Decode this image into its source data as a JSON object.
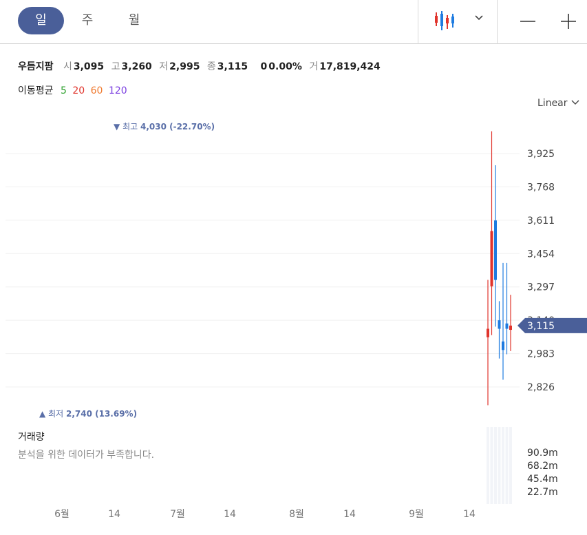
{
  "tabs": [
    "일",
    "주",
    "월"
  ],
  "active_tab": 0,
  "zoom": {
    "out_icon": "minus-icon",
    "in_icon": "plus-icon"
  },
  "chart_type_icon": "candlestick-icon",
  "stock": {
    "name": "우듬지팜",
    "open_label": "시",
    "open": "3,095",
    "high_label": "고",
    "high": "3,260",
    "low_label": "저",
    "low": "2,995",
    "close_label": "종",
    "close": "3,115",
    "change": "0",
    "change_pct": "0.00%",
    "volume_label": "거",
    "volume": "17,819,424"
  },
  "moving_average": {
    "label": "이동평균",
    "periods": [
      {
        "value": "5",
        "color": "#2ca02c"
      },
      {
        "value": "20",
        "color": "#e0342c"
      },
      {
        "value": "60",
        "color": "#f07a30"
      },
      {
        "value": "120",
        "color": "#7b3fe0"
      }
    ]
  },
  "scale_mode": "Linear",
  "volume_section": {
    "title": "거래량",
    "empty_message": "분석을 위한 데이터가 부족합니다.",
    "ticks": [
      "90.9m",
      "68.2m",
      "45.4m",
      "22.7m"
    ]
  },
  "colors": {
    "up": "#e0342c",
    "down": "#1e7be0",
    "accent": "#4a5f99",
    "marker": "#5a6fa8"
  },
  "chart_data": {
    "type": "candlestick",
    "price_ticks": [
      3925,
      3768,
      3611,
      3454,
      3297,
      3140,
      2983,
      2826
    ],
    "price_tick_labels": [
      "3,925",
      "3,768",
      "3,611",
      "3,454",
      "3,297",
      "3,140",
      "2,983",
      "2,826"
    ],
    "current_price": 3115,
    "current_price_label": "3,115",
    "high_marker": {
      "symbol": "▼",
      "label": "최고",
      "value": "4,030 (-22.70%)",
      "price": 4030
    },
    "low_marker": {
      "symbol": "▲",
      "label": "최저",
      "value": "2,740 (13.69%)",
      "price": 2740
    },
    "x_tick_labels": [
      "6월",
      "14",
      "7월",
      "14",
      "8월",
      "14",
      "9월",
      "14"
    ],
    "candles": [
      {
        "open": 3060,
        "high": 3330,
        "low": 2740,
        "close": 3100
      },
      {
        "open": 3300,
        "high": 4030,
        "low": 3070,
        "close": 3560
      },
      {
        "open": 3610,
        "high": 3870,
        "low": 3110,
        "close": 3330
      },
      {
        "open": 3140,
        "high": 3230,
        "low": 2960,
        "close": 3100
      },
      {
        "open": 3040,
        "high": 3410,
        "low": 2860,
        "close": 3000
      },
      {
        "open": 3125,
        "high": 3410,
        "low": 2980,
        "close": 3100
      },
      {
        "open": 3095,
        "high": 3260,
        "low": 2995,
        "close": 3115
      }
    ]
  }
}
